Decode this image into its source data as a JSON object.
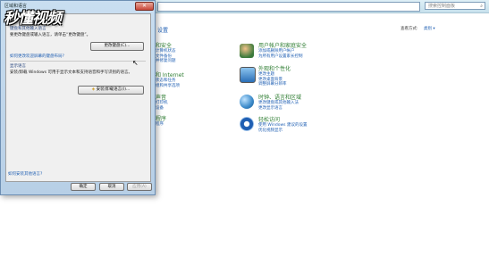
{
  "logo_text": "秒懂视频",
  "control_panel": {
    "search_placeholder": "搜索控制面板",
    "heading": "设置",
    "view_by_label": "查看方式:",
    "view_by_value": "类别 ▾",
    "left_categories": [
      {
        "title": "和安全",
        "links": [
          "计算机状态",
          "文件备份",
          "并修复问题"
        ]
      },
      {
        "title": "和 Internet",
        "links": [
          "状态和任务",
          "组和共享选项"
        ]
      },
      {
        "title": "声音",
        "links": [
          "打印机",
          "设备"
        ]
      },
      {
        "title": "程序",
        "links": [
          "程序"
        ]
      }
    ],
    "right_categories": [
      {
        "title": "用户帐户和家庭安全",
        "links": [
          "添加或删除用户帐户",
          "为所有用户设置家长控制"
        ],
        "icon": "users-icon",
        "color": "#3b7a3b"
      },
      {
        "title": "外观和个性化",
        "links": [
          "更改主题",
          "更改桌面背景",
          "调整屏幕分辨率"
        ],
        "icon": "display-icon",
        "color": "#2a6fb8"
      },
      {
        "title": "时钟、语言和区域",
        "links": [
          "更改键盘或其他输入法",
          "更改显示语言"
        ],
        "icon": "globe-icon",
        "color": "#3a89c9"
      },
      {
        "title": "轻松访问",
        "links": [
          "使用 Windows 建议的设置",
          "优化视频显示"
        ],
        "icon": "accessibility-icon",
        "color": "#1f5fb3"
      }
    ]
  },
  "dialog": {
    "title": "区域和语言",
    "close_label": "✕",
    "section1_title": "键盘和其他输入语言",
    "section1_desc": "要更改键盘或输入语言，请单击“更改键盘”。",
    "change_keyboard_button": "更改键盘(C)...",
    "section1_link": "如何更改欢迎屏幕的键盘布局?",
    "section2_title": "显示语言",
    "section2_desc": "安装/卸载 Windows 可用于显示文本和支持语音和手写识别的语言。",
    "install_button": "安装/卸载语言(I)...",
    "bottom_link": "如何安装其他语言?",
    "ok_button": "确定",
    "cancel_button": "取消",
    "apply_button": "应用(A)"
  }
}
